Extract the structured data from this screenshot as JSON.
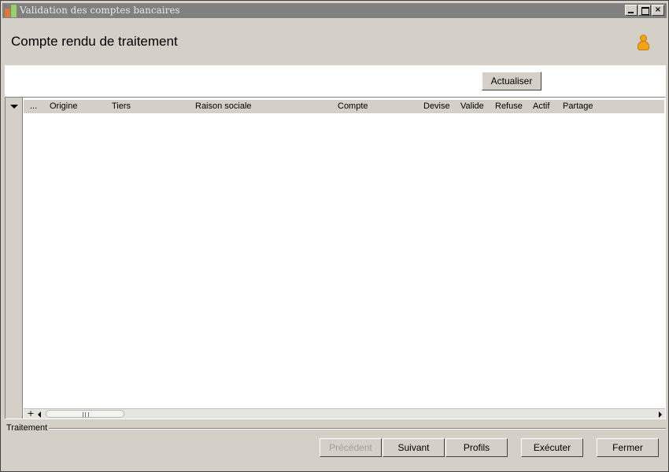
{
  "window": {
    "title": "Validation des comptes bancaires",
    "close_glyph": "×"
  },
  "header": {
    "title": "Compte rendu de traitement"
  },
  "toolbar": {
    "refresh_label": "Actualiser"
  },
  "grid": {
    "columns": [
      "...",
      "Origine",
      "Tiers",
      "Raison sociale",
      "Compte",
      "Devise",
      "Valide",
      "Refuse",
      "Actif",
      "Partage"
    ],
    "rows": [],
    "add_glyph": "+"
  },
  "footer": {
    "group_label": "Traitement",
    "buttons": {
      "previous": "Précédent",
      "next": "Suivant",
      "profiles": "Profils",
      "execute": "Exécuter",
      "close": "Fermer"
    }
  },
  "icons": {
    "app": "app-icon",
    "user": "user-icon"
  },
  "colors": {
    "titlebar": "#808080",
    "window_bg": "#d4d0c8",
    "user_icon": "#f2a31b"
  }
}
